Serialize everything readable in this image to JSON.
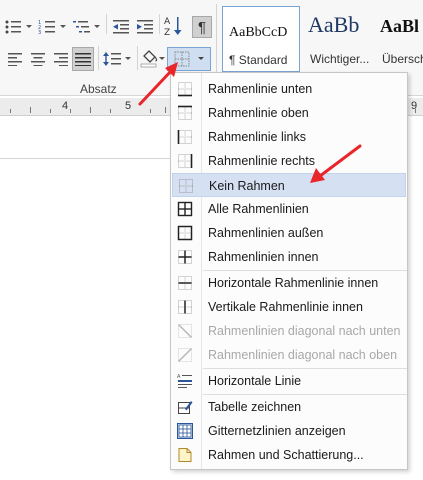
{
  "ribbon": {
    "group_label": "Absatz",
    "pilcrow": "¶",
    "sort_label": "AZ",
    "styles": [
      {
        "preview": "AaBbCcD",
        "name": "¶ Standard"
      },
      {
        "preview": "AaBb",
        "name": "Wichtiger..."
      },
      {
        "preview": "AaBl",
        "name": "Überschr"
      }
    ]
  },
  "ruler": {
    "numbers": [
      "4",
      "5",
      "9"
    ]
  },
  "menu": {
    "items": [
      {
        "label": "Rahmenlinie unten",
        "icon": "border-bottom-icon",
        "state": "enabled"
      },
      {
        "label": "Rahmenlinie oben",
        "icon": "border-top-icon",
        "state": "enabled"
      },
      {
        "label": "Rahmenlinie links",
        "icon": "border-left-icon",
        "state": "enabled"
      },
      {
        "label": "Rahmenlinie rechts",
        "icon": "border-right-icon",
        "state": "enabled"
      },
      {
        "label": "Kein Rahmen",
        "icon": "no-border-icon",
        "state": "hover"
      },
      {
        "label": "Alle Rahmenlinien",
        "icon": "all-borders-icon",
        "state": "enabled"
      },
      {
        "label": "Rahmenlinien außen",
        "icon": "outside-borders-icon",
        "state": "enabled"
      },
      {
        "label": "Rahmenlinien innen",
        "icon": "inside-borders-icon",
        "state": "enabled"
      },
      {
        "label": "Horizontale Rahmenlinie innen",
        "icon": "inside-horizontal-border-icon",
        "state": "enabled"
      },
      {
        "label": "Vertikale Rahmenlinie innen",
        "icon": "inside-vertical-border-icon",
        "state": "enabled"
      },
      {
        "label": "Rahmenlinien diagonal nach unten",
        "icon": "diagonal-down-border-icon",
        "state": "disabled"
      },
      {
        "label": "Rahmenlinien diagonal nach oben",
        "icon": "diagonal-up-border-icon",
        "state": "disabled"
      },
      {
        "label": "Horizontale Linie",
        "icon": "horizontal-line-icon",
        "state": "enabled"
      },
      {
        "label": "Tabelle zeichnen",
        "icon": "draw-table-icon",
        "state": "enabled"
      },
      {
        "label": "Gitternetzlinien anzeigen",
        "icon": "gridlines-icon",
        "state": "enabled"
      },
      {
        "label": "Rahmen und Schattierung...",
        "icon": "borders-shading-icon",
        "state": "enabled"
      }
    ]
  },
  "colors": {
    "annotation_arrow": "#e8262b",
    "hover_bg": "#d5e1f2",
    "accent": "#2b579a"
  }
}
